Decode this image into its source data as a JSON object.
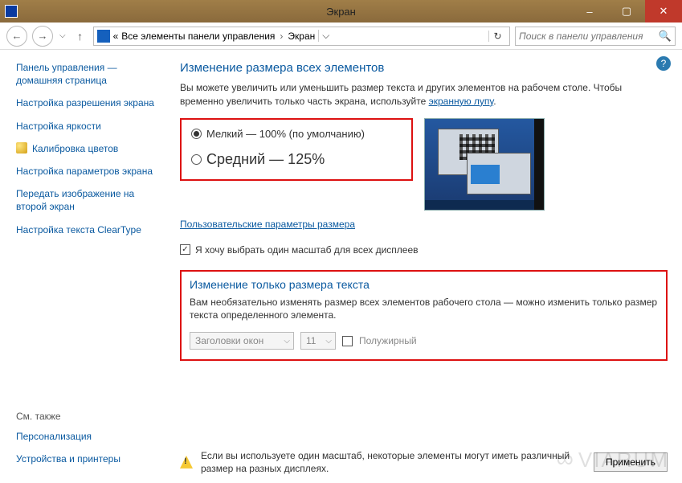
{
  "titlebar": {
    "title": "Экран"
  },
  "nav": {
    "crumb_prefix": "«",
    "crumb1": "Все элементы панели управления",
    "crumb2": "Экран"
  },
  "search": {
    "placeholder": "Поиск в панели управления"
  },
  "sidebar": {
    "links": [
      "Панель управления — домашняя страница",
      "Настройка разрешения экрана",
      "Настройка яркости",
      "Калибровка цветов",
      "Настройка параметров экрана",
      "Передать изображение на второй экран",
      "Настройка текста ClearType"
    ],
    "seealso_label": "См. также",
    "seealso": [
      "Персонализация",
      "Устройства и принтеры"
    ]
  },
  "main": {
    "heading": "Изменение размера всех элементов",
    "desc_a": "Вы можете увеличить или уменьшить размер текста и других элементов на рабочем столе. Чтобы временно увеличить только часть экрана, используйте ",
    "desc_link": "экранную лупу",
    "desc_b": ".",
    "radio1": "Мелкий — 100% (по умолчанию)",
    "radio2": "Средний — 125%",
    "custom_link": "Пользовательские параметры размера",
    "checkbox_label": "Я хочу выбрать один масштаб для всех дисплеев",
    "text_heading": "Изменение только размера текста",
    "text_desc": "Вам необязательно изменять размер всех элементов рабочего стола — можно изменить только размер текста определенного элемента.",
    "select_element": "Заголовки окон",
    "select_size": "11",
    "bold_label": "Полужирный",
    "warning": "Если вы используете один масштаб, некоторые элементы могут иметь различный размер на разных дисплеях.",
    "apply": "Применить"
  },
  "watermark": "VIARUM"
}
